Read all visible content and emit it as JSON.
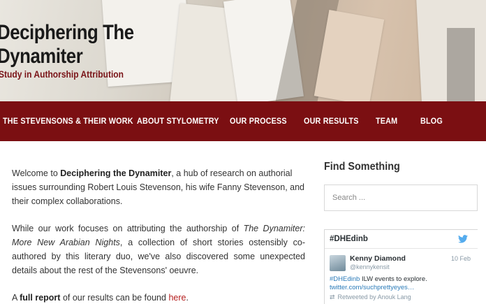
{
  "header": {
    "title_line1": "Deciphering The",
    "title_line2": "Dynamiter",
    "tagline": "Study in Authorship Attribution"
  },
  "nav": {
    "items": [
      {
        "label": "THE STEVENSONS & THEIR WORK"
      },
      {
        "label": "ABOUT STYLOMETRY"
      },
      {
        "label": "OUR PROCESS"
      },
      {
        "label": "OUR RESULTS"
      },
      {
        "label": "TEAM"
      },
      {
        "label": "BLOG"
      }
    ]
  },
  "main": {
    "p1_intro": "Welcome to ",
    "p1_bold": "Deciphering the Dynamiter",
    "p1_rest": ", a hub of research on authorial issues surrounding Robert Louis Stevenson, his wife Fanny Stevenson, and their complex collaborations.",
    "p2_intro": "While our work focuses on attributing the authorship of ",
    "p2_italic": "The Dynamiter: More New Arabian Nights",
    "p2_rest": ", a collection of short stories ostensibly co-authored by this literary duo, we've also discovered some unexpected details about the rest of the Stevensons' oeuvre.",
    "p3_intro": "A ",
    "p3_bold": "full report",
    "p3_mid": " of our results can be found ",
    "p3_link": "here",
    "p3_end": "."
  },
  "sidebar": {
    "heading": "Find Something",
    "search_placeholder": "Search ...",
    "twitter": {
      "hashtag": "#DHEdinb",
      "name": "Kenny Diamond",
      "handle": "@kennykensit",
      "date": "10 Feb",
      "text_hashtag": "#DHEdinb",
      "text_rest": " ILW events to explore.",
      "link": "twitter.com/suchprettyeyes…",
      "retweet": "Retweeted by Anouk Lang",
      "bird_color": "#55acee"
    }
  },
  "colors": {
    "nav_bg": "#7b0f12",
    "tagline": "#7a1418",
    "link": "#b51e1e"
  }
}
